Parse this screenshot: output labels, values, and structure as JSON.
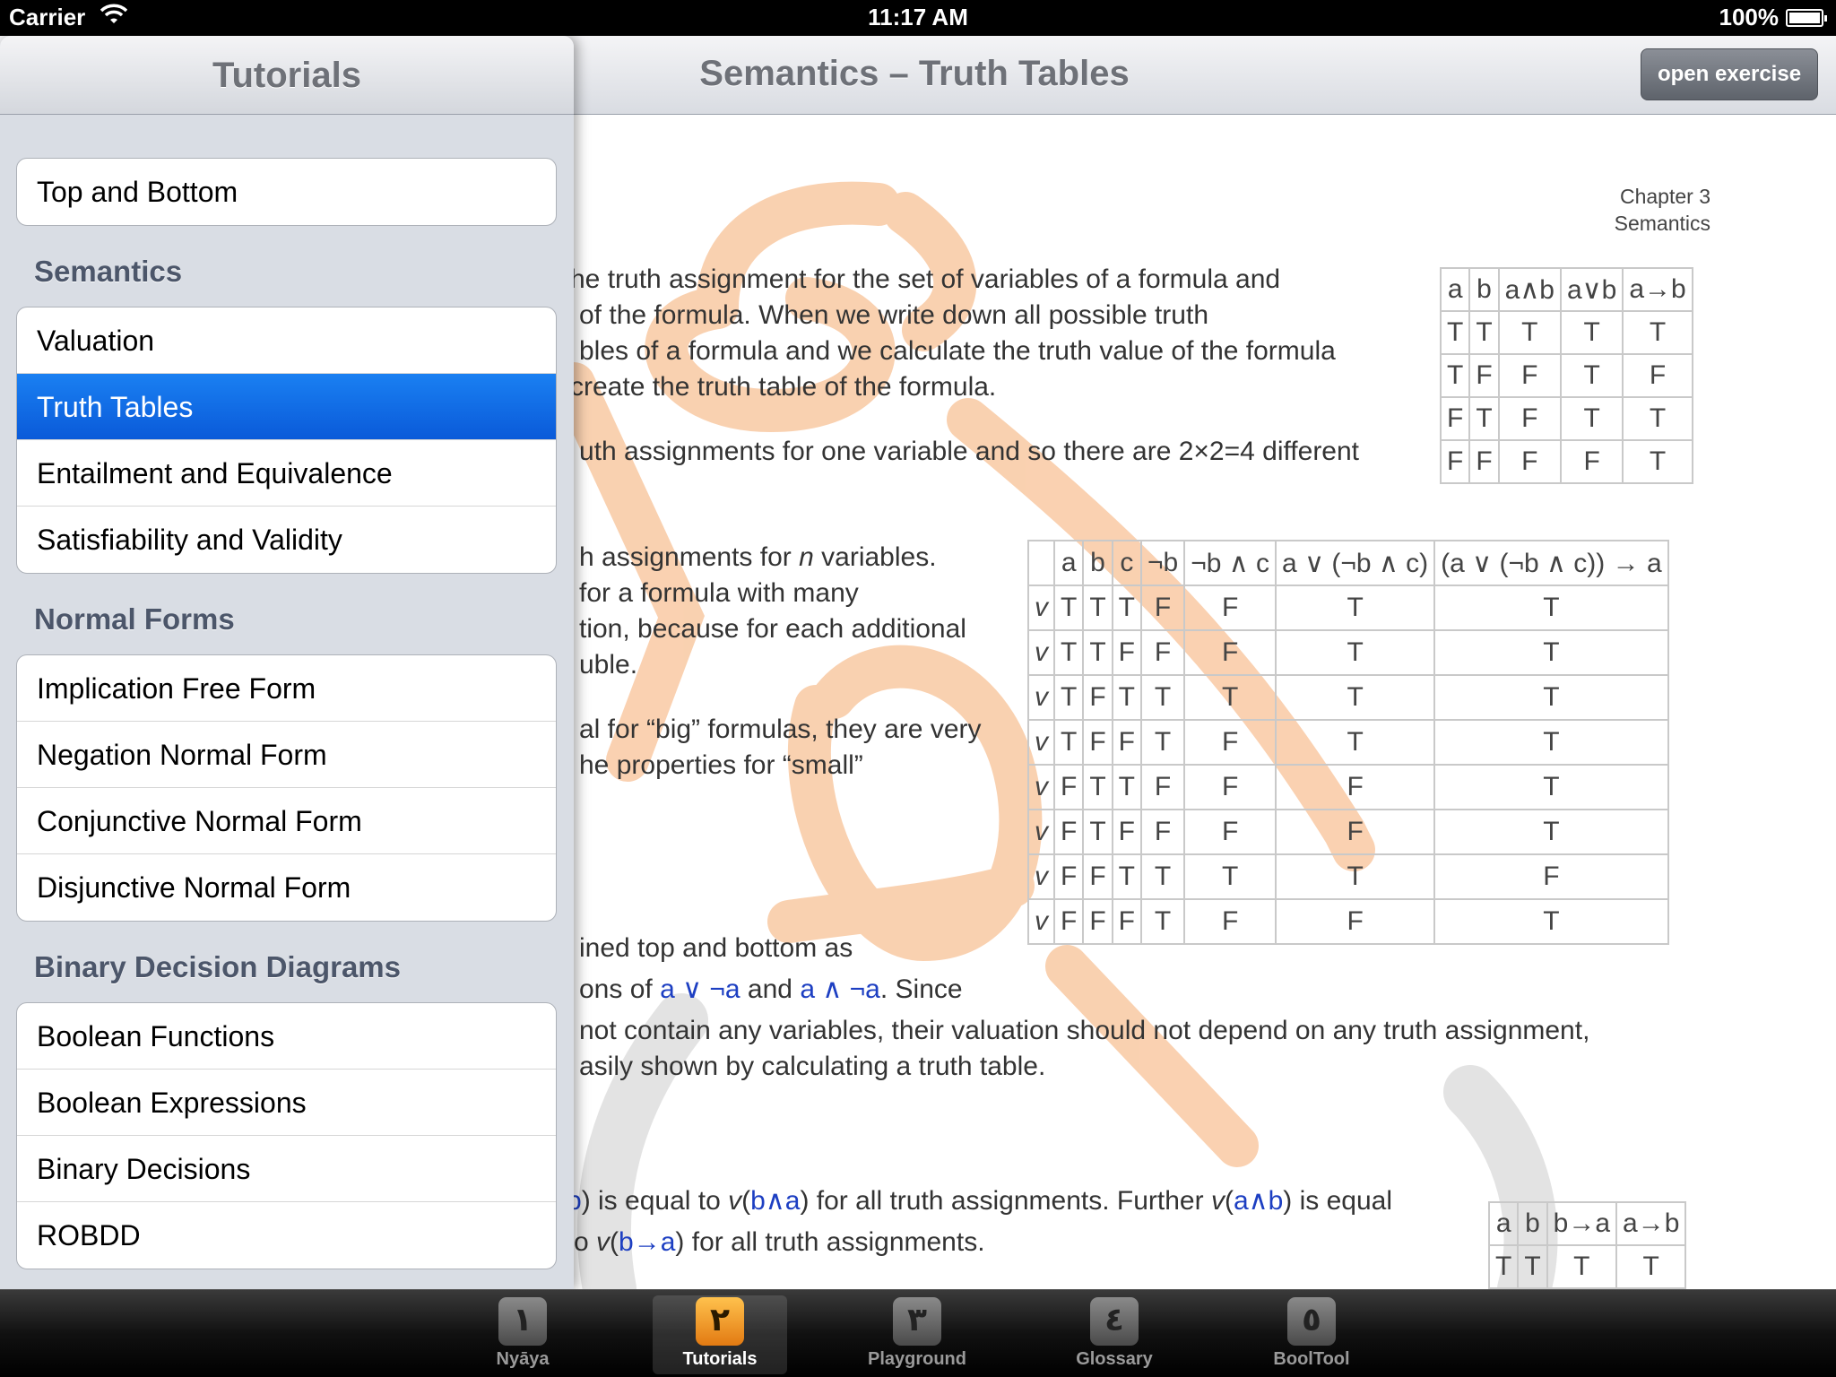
{
  "status_bar": {
    "carrier": "Carrier",
    "time": "11:17 AM",
    "battery": "100%"
  },
  "nav": {
    "title": "Semantics – Truth Tables",
    "open_exercise": "open exercise"
  },
  "sidebar": {
    "title": "Tutorials",
    "top_items": [
      "Top and Bottom"
    ],
    "sections": [
      {
        "title": "Semantics",
        "items": [
          "Valuation",
          "Truth Tables",
          "Entailment and Equivalence",
          "Satisfiability and Validity"
        ]
      },
      {
        "title": "Normal Forms",
        "items": [
          "Implication Free Form",
          "Negation Normal Form",
          "Conjunctive Normal Form",
          "Disjunctive Normal Form"
        ]
      },
      {
        "title": "Binary Decision Diagrams",
        "items": [
          "Boolean Functions",
          "Boolean Expressions",
          "Binary Decisions",
          "ROBDD"
        ]
      }
    ],
    "selected": "Truth Tables"
  },
  "doc": {
    "chapter": "Chapter 3",
    "chapter_title": "Semantics",
    "para1": [
      "he truth assignment for the set of variables of a formula and",
      "of the formula. When we write down all possible truth",
      "bles of a formula and we calculate the truth value of the formula",
      "create the truth table of the formula."
    ],
    "para2": "uth assignments for one variable and so there are 2×2=4 different",
    "para3": [
      "h assignments for ",
      "n",
      " variables."
    ],
    "para3b": [
      "for a formula with many",
      "tion, because for each additional",
      "uble."
    ],
    "para4": [
      "al for “big” formulas, they are very",
      "he properties for “small”"
    ],
    "para5": "ined top and bottom as",
    "para6": {
      "pre": "ons of ",
      "f1": "a ∨ ¬a",
      "mid": " and ",
      "f2": "a ∧ ¬a",
      "post": ". Since"
    },
    "para7": [
      "not contain any variables, their valuation should not depend on any truth assignment,",
      "asily shown by calculating a truth table."
    ],
    "para8": {
      "pre": ") is equal to ",
      "v1": "v",
      "p1": "(",
      "f1": "b∧a",
      "p2": ") for all truth assignments. Further ",
      "v2": "v",
      "p3": "(",
      "f2": "a∧b",
      "p4": ") is equal"
    },
    "para9": {
      "pre": "o ",
      "v": "v",
      "p1": "(",
      "f": "b→a",
      "p2": ") for all truth assignments."
    },
    "para8_lead": "b"
  },
  "table1": {
    "headers": [
      "a",
      "b",
      "a∧b",
      "a∨b",
      "a→b"
    ],
    "rows": [
      [
        "T",
        "T",
        "T",
        "T",
        "T"
      ],
      [
        "T",
        "F",
        "F",
        "T",
        "F"
      ],
      [
        "F",
        "T",
        "F",
        "T",
        "T"
      ],
      [
        "F",
        "F",
        "F",
        "F",
        "T"
      ]
    ]
  },
  "table2": {
    "headers": [
      "",
      "a",
      "b",
      "c",
      "¬b",
      "¬b ∧ c",
      "a ∨ (¬b ∧ c)",
      "(a ∨ (¬b ∧ c)) → a"
    ],
    "rows": [
      [
        "v",
        "T",
        "T",
        "T",
        "F",
        "F",
        "T",
        "T"
      ],
      [
        "v",
        "T",
        "T",
        "F",
        "F",
        "F",
        "T",
        "T"
      ],
      [
        "v",
        "T",
        "F",
        "T",
        "T",
        "T",
        "T",
        "T"
      ],
      [
        "v",
        "T",
        "F",
        "F",
        "T",
        "F",
        "T",
        "T"
      ],
      [
        "v",
        "F",
        "T",
        "T",
        "F",
        "F",
        "F",
        "T"
      ],
      [
        "v",
        "F",
        "T",
        "F",
        "F",
        "F",
        "F",
        "T"
      ],
      [
        "v",
        "F",
        "F",
        "T",
        "T",
        "T",
        "T",
        "F"
      ],
      [
        "v",
        "F",
        "F",
        "F",
        "T",
        "F",
        "F",
        "T"
      ]
    ]
  },
  "table3": {
    "headers": [
      "a",
      "b",
      "b→a",
      "a→b"
    ],
    "rows": [
      [
        "T",
        "T",
        "T",
        "T"
      ]
    ]
  },
  "tabs": [
    {
      "icon": "١",
      "label": "Nyāya"
    },
    {
      "icon": "٢",
      "label": "Tutorials",
      "active": true
    },
    {
      "icon": "٣",
      "label": "Playground"
    },
    {
      "icon": "٤",
      "label": "Glossary"
    },
    {
      "icon": "٥",
      "label": "BoolTool"
    }
  ],
  "colors": {
    "selected": "#0a5ad9",
    "formula": "#1d3fc2",
    "accent_tab": "#e27a12"
  }
}
